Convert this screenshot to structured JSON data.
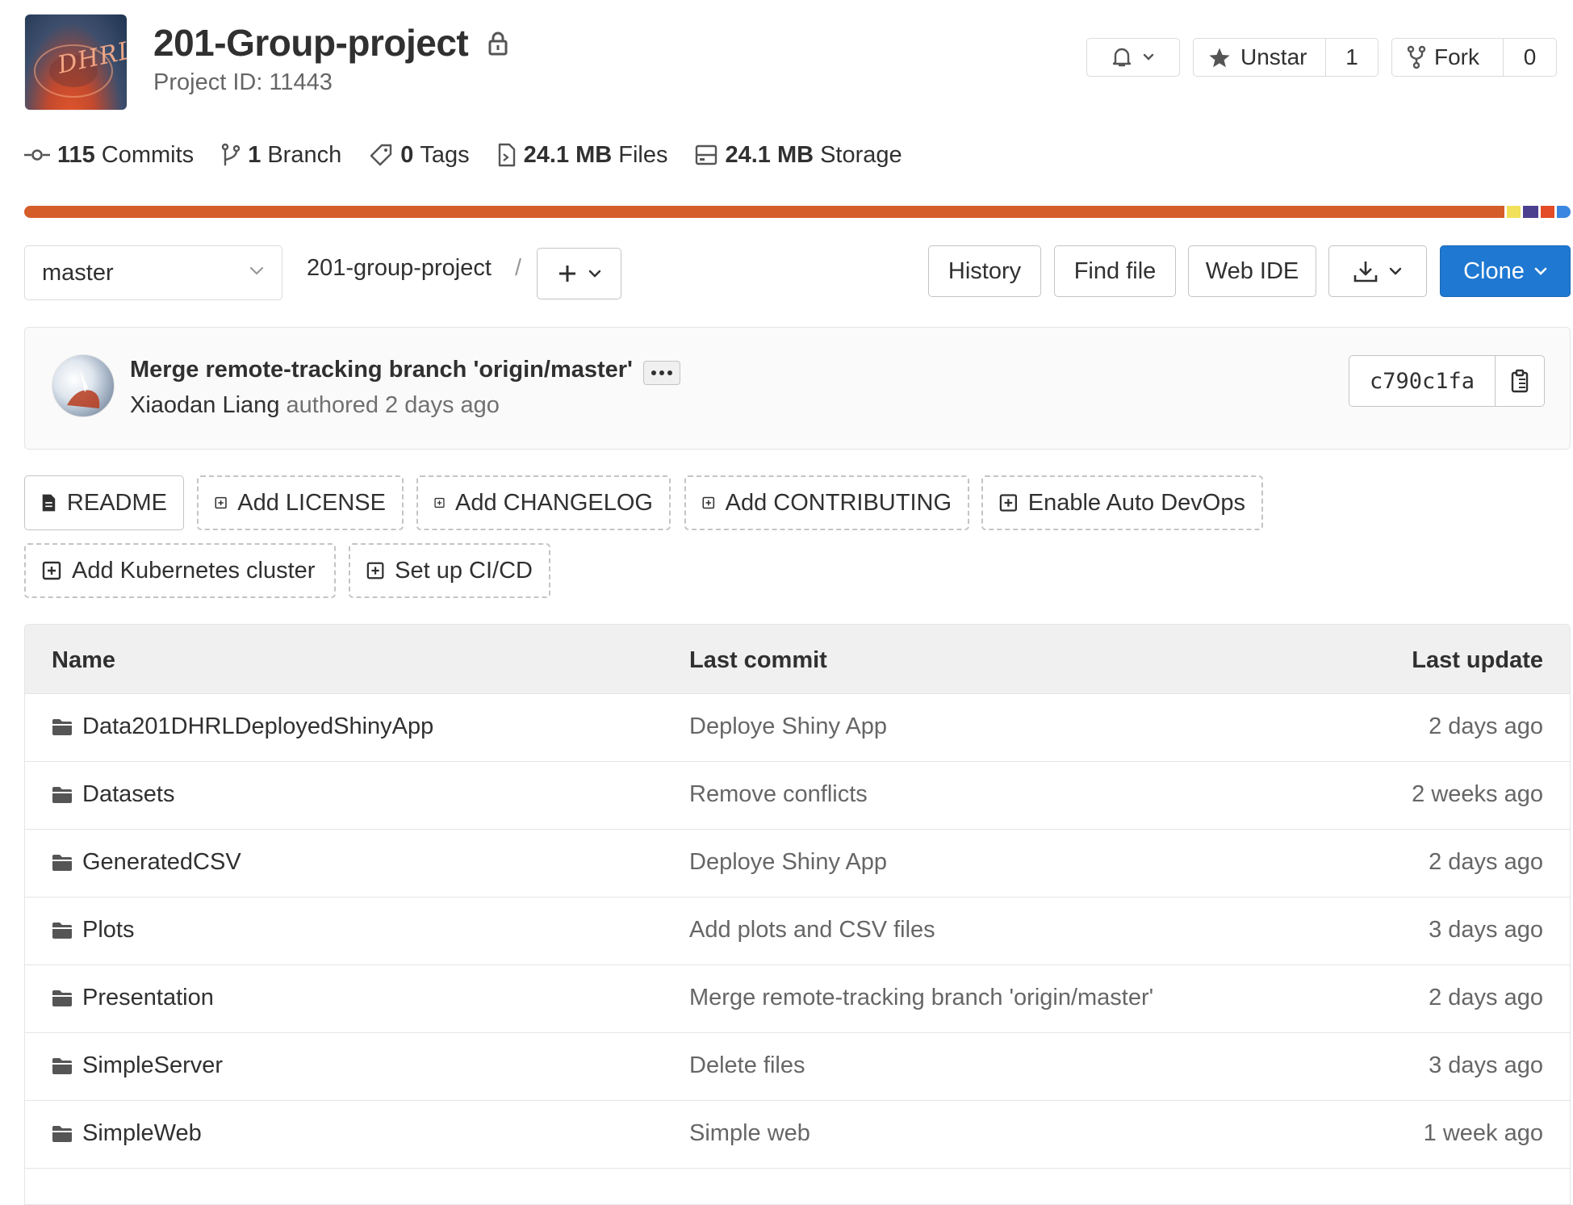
{
  "project": {
    "title": "201-Group-project",
    "id_label": "Project ID: 11443",
    "avatar_text": "DHRL"
  },
  "header_actions": {
    "star_label": "Unstar",
    "star_count": "1",
    "fork_label": "Fork",
    "fork_count": "0"
  },
  "stats": {
    "commits_count": "115",
    "commits_label": "Commits",
    "branches_count": "1",
    "branches_label": "Branch",
    "tags_count": "0",
    "tags_label": "Tags",
    "files_size": "24.1 MB",
    "files_label": "Files",
    "storage_size": "24.1 MB",
    "storage_label": "Storage"
  },
  "language_bar": {
    "segments": [
      {
        "fraction": 0.963,
        "color": "#d55d2a"
      },
      {
        "fraction": 0.009,
        "color": "#f1e05a"
      },
      {
        "fraction": 0.01,
        "color": "#4b3f8f"
      },
      {
        "fraction": 0.009,
        "color": "#e34c26"
      },
      {
        "fraction": 0.009,
        "color": "#3a86e0"
      }
    ]
  },
  "toolbar": {
    "branch": "master",
    "path": "201-group-project",
    "separator": "/",
    "history": "History",
    "find_file": "Find file",
    "web_ide": "Web IDE",
    "clone": "Clone"
  },
  "commit": {
    "title": "Merge remote-tracking branch 'origin/master'",
    "author": "Xiaodan Liang",
    "when": " authored 2 days ago",
    "sha": "c790c1fa"
  },
  "quick_actions": {
    "readme": "README",
    "add_license": "Add LICENSE",
    "add_changelog": "Add CHANGELOG",
    "add_contributing": "Add CONTRIBUTING",
    "enable_auto_devops": "Enable Auto DevOps",
    "add_kubernetes": "Add Kubernetes cluster",
    "setup_cicd": "Set up CI/CD"
  },
  "table": {
    "headers": {
      "name": "Name",
      "last_commit": "Last commit",
      "last_update": "Last update"
    },
    "rows": [
      {
        "name": "Data201DHRLDeployedShinyApp",
        "commit": "Deploye Shiny App",
        "updated": "2 days ago"
      },
      {
        "name": "Datasets",
        "commit": "Remove conflicts",
        "updated": "2 weeks ago"
      },
      {
        "name": "GeneratedCSV",
        "commit": "Deploye Shiny App",
        "updated": "2 days ago"
      },
      {
        "name": "Plots",
        "commit": "Add plots and CSV files",
        "updated": "3 days ago"
      },
      {
        "name": "Presentation",
        "commit": "Merge remote-tracking branch 'origin/master'",
        "updated": "2 days ago"
      },
      {
        "name": "SimpleServer",
        "commit": "Delete files",
        "updated": "3 days ago"
      },
      {
        "name": "SimpleWeb",
        "commit": "Simple web",
        "updated": "1 week ago"
      }
    ]
  },
  "icons": {
    "folder": "folder-icon",
    "lock": "lock-icon",
    "bell": "bell-icon",
    "star": "star-icon",
    "fork": "fork-icon"
  }
}
